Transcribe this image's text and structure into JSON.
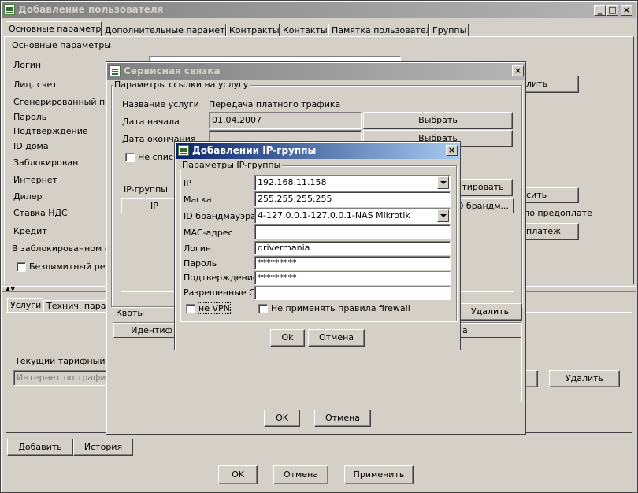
{
  "main": {
    "title": "Добавление пользователя",
    "tabs": [
      "Основные параметры",
      "Дополнительные параметры",
      "Контракты",
      "Контакты",
      "Памятка пользователя",
      "Группы"
    ],
    "basic_group": "Основные параметры",
    "labels": [
      "Логин",
      "Лиц. счет",
      "Сгенерированный паро",
      "Пароль",
      "Подтверждение",
      "ID дома",
      "Заблокирован",
      "Интернет",
      "Дилер",
      "Ставка НДС",
      "Кредит",
      "В заблокированном сос"
    ],
    "unlimited": "Безлимитный реж",
    "right_fragments": {
      "b1": "лить",
      "b2": "сить",
      "pre": "по предоплате",
      "b3": "платеж"
    },
    "bottom_tabs": [
      "Услуги",
      "Технич. парам"
    ],
    "tariff_label": "Текущий тарифный пл",
    "tariff_value": "Интернет по трафику",
    "delete_btn": "Удалить",
    "add_btn": "Добавить",
    "history_btn": "История",
    "ok": "OK",
    "cancel": "Отмена",
    "apply": "Применить"
  },
  "service": {
    "title": "Сервисная связка",
    "group": "Параметры ссылки на услугу",
    "service_name_label": "Название услуги",
    "service_name_value": "Передача платного трафика",
    "start_label": "Дата начала",
    "start_value": "01.04.2007",
    "end_label": "Дата окончания",
    "choose": "Выбрать",
    "not_list": "Не списы",
    "ip_groups_label": "IP-группы",
    "ip_col": "IP",
    "edit_btn": "тировать",
    "firewall_col": "D брандм...",
    "quotas_label": "Квоты",
    "quota_col": "Идентиф",
    "quota_col_right": "а",
    "delete": "Удалить",
    "ok": "OK",
    "cancel": "Отмена"
  },
  "ipgroup": {
    "title": "Добавлении IP-группы",
    "group": "Параметры IP-группы",
    "fields": [
      {
        "label": "IP",
        "value": "192.168.11.158",
        "combo": true
      },
      {
        "label": "Маска",
        "value": "255.255.255.255",
        "combo": false
      },
      {
        "label": "ID брандмауэра",
        "value": "4-127.0.0.1-127.0.0.1-NAS Mikrotik",
        "combo": true
      },
      {
        "label": "MAC-адрес",
        "value": "",
        "combo": false
      },
      {
        "label": "Логин",
        "value": "drivermania",
        "combo": false
      },
      {
        "label": "Пароль",
        "value": "*********",
        "combo": false
      },
      {
        "label": "Подтверждение",
        "value": "*********",
        "combo": false
      },
      {
        "label": "Разрешенные CID",
        "value": "",
        "combo": false
      }
    ],
    "no_vpn": "не VPN",
    "no_firewall": "Не применять правила firewall",
    "ok": "Ok",
    "cancel": "Отмена"
  }
}
